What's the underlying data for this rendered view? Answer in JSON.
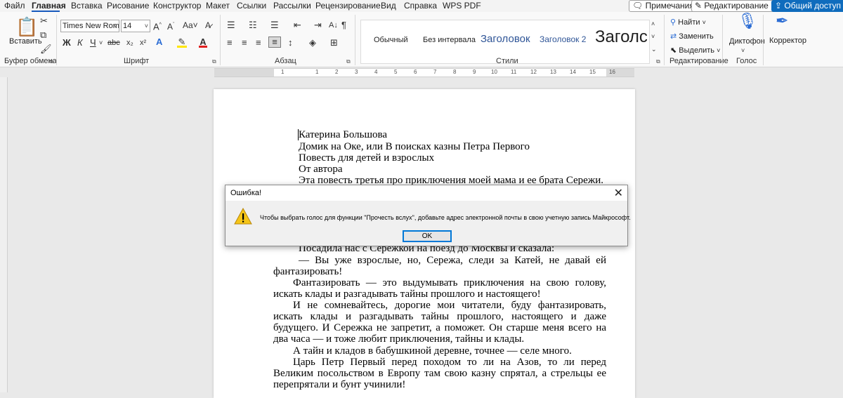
{
  "menu": {
    "items": [
      "Файл",
      "Главная",
      "Вставка",
      "Рисование",
      "Конструктор",
      "Макет",
      "Ссылки",
      "Рассылки",
      "Рецензирование",
      "Вид",
      "Справка",
      "WPS PDF"
    ],
    "active": "Главная"
  },
  "top_buttons": {
    "comments": "Примечания",
    "editing": "Редактирование",
    "share": "Общий доступ"
  },
  "ribbon": {
    "clipboard": {
      "paste_label": "Вставить",
      "group_label": "Буфер обмена"
    },
    "font": {
      "font_name": "Times New Roman",
      "font_size": "14",
      "group_label": "Шрифт",
      "bold": "Ж",
      "italic": "К",
      "underline": "Ч",
      "strike": "abc",
      "sub": "x₂",
      "sup": "x²"
    },
    "paragraph": {
      "group_label": "Абзац"
    },
    "styles": {
      "items": [
        "Обычный",
        "Без интервала",
        "Заголовок",
        "Заголовок 2",
        "Заголс"
      ],
      "group_label": "Стили"
    },
    "editing": {
      "find": "Найти",
      "replace": "Заменить",
      "select": "Выделить",
      "group_label": "Редактирование"
    },
    "voice": {
      "dictate": "Диктофон",
      "group_label": "Голос"
    },
    "editor": {
      "label": "Корректор"
    }
  },
  "ruler": {
    "numbers": [
      "1",
      "1",
      "2",
      "3",
      "4",
      "5",
      "6",
      "7",
      "8",
      "9",
      "10",
      "11",
      "12",
      "13",
      "14",
      "15",
      "16"
    ]
  },
  "document": {
    "lines": [
      "Катерина Большова",
      "Домик на Оке, или В поисках казны Петра Первого",
      "Повесть для детей и взрослых",
      "От автора",
      "Эта повесть третья про приключения моей мама и ее брата Сережи."
    ],
    "paragraphs": [
      "Посадила нас с Сережкой на поезд до Москвы и сказала:",
      "— Вы уже взрослые, но, Сережа, следи за Катей, не давай ей фантазировать!",
      "Фантазировать — это выдумывать приключения на свою голову, искать клады и разгадывать тайны прошлого и настоящего!",
      "И не сомневайтесь, дорогие мои читатели, буду фантазировать, искать клады и разгадывать тайны прошлого, настоящего и даже будущего. И Сережка не запретит, а поможет. Он старше меня всего на два часа — и тоже любит приключения, тайны и клады.",
      "А тайн и кладов в бабушкиной деревне, точнее — селе много.",
      "Царь Петр Первый перед походом то ли на Азов, то ли перед Великим посольством в Европу там свою казну спрятал, а стрельцы ее перепрятали и бунт учинили!"
    ]
  },
  "dialog": {
    "title": "Ошибка!",
    "message": "Чтобы выбрать голос для функции \"Прочесть вслух\", добавьте адрес электронной почты в свою учетную запись Майкрософт.",
    "ok": "OK"
  },
  "colors": {
    "accent": "#185abd",
    "share_bg": "#0f6cbd",
    "warning": "#f5c518",
    "highlight": "#ffe600",
    "font_color": "#e02020"
  }
}
